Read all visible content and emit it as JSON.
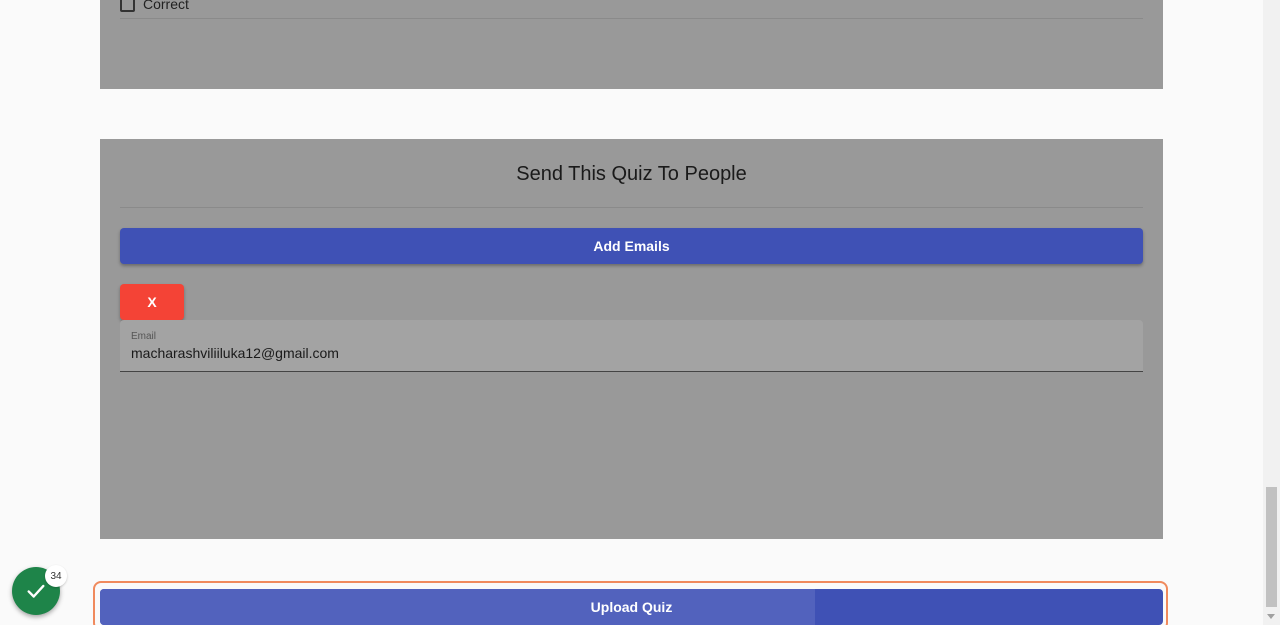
{
  "top_card": {
    "checkbox_label": "Correct",
    "checked": false
  },
  "send_card": {
    "title": "Send This Quiz To People",
    "add_emails_label": "Add Emails",
    "remove_label": "X",
    "email_field": {
      "label": "Email",
      "value": "macharashviliiluka12@gmail.com"
    }
  },
  "upload": {
    "label": "Upload Quiz",
    "progress": 0.673
  },
  "status_badge": {
    "count": "34",
    "icon": "checkmark-icon"
  },
  "colors": {
    "primary": "#3f51b5",
    "danger": "#f44336",
    "success": "#1e8449",
    "card": "#999999",
    "outline": "#f08a5d"
  }
}
